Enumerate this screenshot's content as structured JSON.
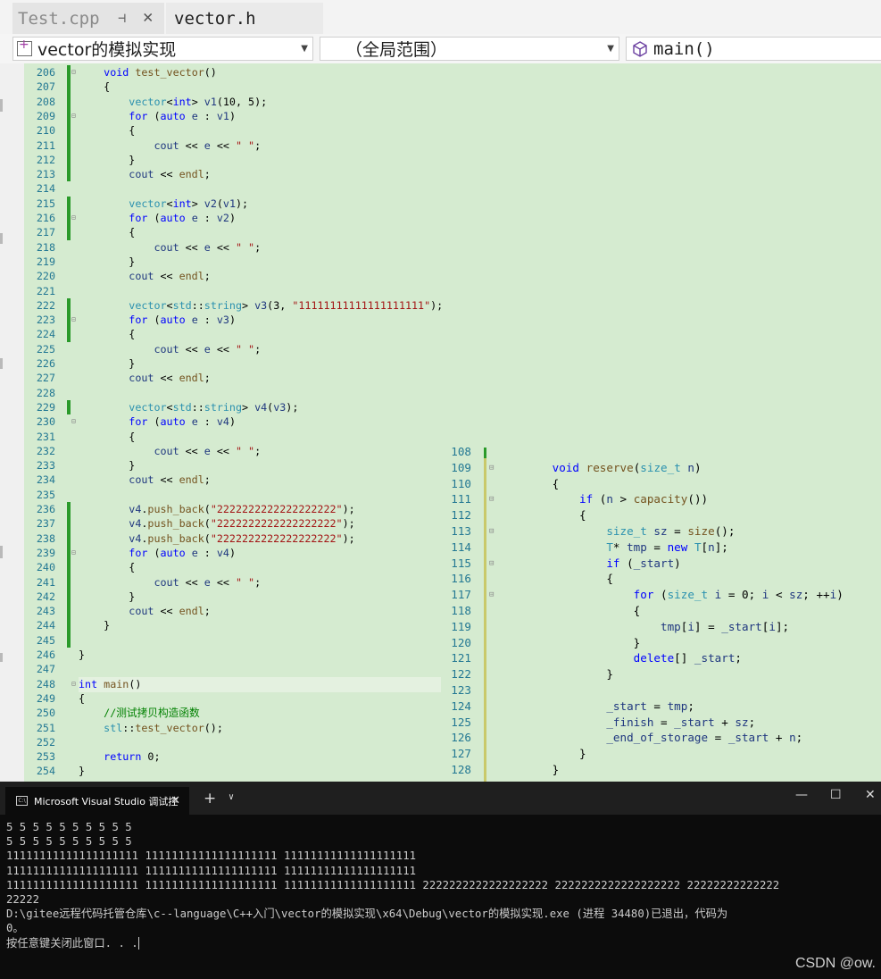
{
  "tabs": [
    {
      "label": "Test.cpp",
      "active": false,
      "pin": "⊣",
      "close": "✕"
    },
    {
      "label": "vector.h",
      "active": true
    }
  ],
  "navbar": {
    "project": "vector的模拟实现",
    "scope": "（全局范围）",
    "member": "main()"
  },
  "editor": {
    "lines": [
      {
        "n": "206",
        "html": "    <span class='kw'>void</span> <span class='fn'>test_vector</span>()"
      },
      {
        "n": "207",
        "html": "    {"
      },
      {
        "n": "208",
        "html": "        <span class='ty'>vector</span>&lt;<span class='kw'>int</span>&gt; <span class='var'>v1</span>(10, 5);"
      },
      {
        "n": "209",
        "html": "        <span class='kw'>for</span> (<span class='kw'>auto</span> <span class='var'>e</span> : <span class='var'>v1</span>)"
      },
      {
        "n": "210",
        "html": "        {"
      },
      {
        "n": "211",
        "html": "            <span class='var'>cout</span> &lt;&lt; <span class='var'>e</span> &lt;&lt; <span class='str'>\" \"</span>;"
      },
      {
        "n": "212",
        "html": "        }"
      },
      {
        "n": "213",
        "html": "        <span class='var'>cout</span> &lt;&lt; <span class='fn'>endl</span>;"
      },
      {
        "n": "214",
        "html": ""
      },
      {
        "n": "215",
        "html": "        <span class='ty'>vector</span>&lt;<span class='kw'>int</span>&gt; <span class='var'>v2</span>(<span class='var'>v1</span>);"
      },
      {
        "n": "216",
        "html": "        <span class='kw'>for</span> (<span class='kw'>auto</span> <span class='var'>e</span> : <span class='var'>v2</span>)"
      },
      {
        "n": "217",
        "html": "        {"
      },
      {
        "n": "218",
        "html": "            <span class='var'>cout</span> &lt;&lt; <span class='var'>e</span> &lt;&lt; <span class='str'>\" \"</span>;"
      },
      {
        "n": "219",
        "html": "        }"
      },
      {
        "n": "220",
        "html": "        <span class='var'>cout</span> &lt;&lt; <span class='fn'>endl</span>;"
      },
      {
        "n": "221",
        "html": ""
      },
      {
        "n": "222",
        "html": "        <span class='ty'>vector</span>&lt;<span class='ns'>std</span>::<span class='ty'>string</span>&gt; <span class='var'>v3</span>(3, <span class='str'>\"11111111111111111111\"</span>);"
      },
      {
        "n": "223",
        "html": "        <span class='kw'>for</span> (<span class='kw'>auto</span> <span class='var'>e</span> : <span class='var'>v3</span>)"
      },
      {
        "n": "224",
        "html": "        {"
      },
      {
        "n": "225",
        "html": "            <span class='var'>cout</span> &lt;&lt; <span class='var'>e</span> &lt;&lt; <span class='str'>\" \"</span>;"
      },
      {
        "n": "226",
        "html": "        }"
      },
      {
        "n": "227",
        "html": "        <span class='var'>cout</span> &lt;&lt; <span class='fn'>endl</span>;"
      },
      {
        "n": "228",
        "html": ""
      },
      {
        "n": "229",
        "html": "        <span class='ty'>vector</span>&lt;<span class='ns'>std</span>::<span class='ty'>string</span>&gt; <span class='var'>v4</span>(<span class='var'>v3</span>);"
      },
      {
        "n": "230",
        "html": "        <span class='kw'>for</span> (<span class='kw'>auto</span> <span class='var'>e</span> : <span class='var'>v4</span>)"
      },
      {
        "n": "231",
        "html": "        {"
      },
      {
        "n": "232",
        "html": "            <span class='var'>cout</span> &lt;&lt; <span class='var'>e</span> &lt;&lt; <span class='str'>\" \"</span>;"
      },
      {
        "n": "233",
        "html": "        }"
      },
      {
        "n": "234",
        "html": "        <span class='var'>cout</span> &lt;&lt; <span class='fn'>endl</span>;"
      },
      {
        "n": "235",
        "html": ""
      },
      {
        "n": "236",
        "html": "        <span class='var'>v4</span>.<span class='fn'>push_back</span>(<span class='str'>\"2222222222222222222\"</span>);"
      },
      {
        "n": "237",
        "html": "        <span class='var'>v4</span>.<span class='fn'>push_back</span>(<span class='str'>\"2222222222222222222\"</span>);"
      },
      {
        "n": "238",
        "html": "        <span class='var'>v4</span>.<span class='fn'>push_back</span>(<span class='str'>\"2222222222222222222\"</span>);"
      },
      {
        "n": "239",
        "html": "        <span class='kw'>for</span> (<span class='kw'>auto</span> <span class='var'>e</span> : <span class='var'>v4</span>)"
      },
      {
        "n": "240",
        "html": "        {"
      },
      {
        "n": "241",
        "html": "            <span class='var'>cout</span> &lt;&lt; <span class='var'>e</span> &lt;&lt; <span class='str'>\" \"</span>;"
      },
      {
        "n": "242",
        "html": "        }"
      },
      {
        "n": "243",
        "html": "        <span class='var'>cout</span> &lt;&lt; <span class='fn'>endl</span>;"
      },
      {
        "n": "244",
        "html": "    }"
      },
      {
        "n": "245",
        "html": ""
      },
      {
        "n": "246",
        "html": "}"
      },
      {
        "n": "247",
        "html": ""
      },
      {
        "n": "248",
        "html": "<span class='kw'>int</span> <span class='fn'>main</span>()"
      },
      {
        "n": "249",
        "html": "{"
      },
      {
        "n": "250",
        "html": "    <span class='cm'>//测试拷贝构造函数</span>"
      },
      {
        "n": "251",
        "html": "    <span class='ns'>stl</span>::<span class='fn'>test_vector</span>();"
      },
      {
        "n": "252",
        "html": ""
      },
      {
        "n": "253",
        "html": "    <span class='kw'>return</span> 0;"
      },
      {
        "n": "254",
        "html": "}"
      }
    ],
    "peek": [
      {
        "n": "108",
        "html": ""
      },
      {
        "n": "109",
        "html": "        <span class='kw'>void</span> <span class='fn'>reserve</span>(<span class='ty'>size_t</span> <span class='var'>n</span>)"
      },
      {
        "n": "110",
        "html": "        {"
      },
      {
        "n": "111",
        "html": "            <span class='kw'>if</span> (<span class='var'>n</span> &gt; <span class='fn'>capacity</span>())"
      },
      {
        "n": "112",
        "html": "            {"
      },
      {
        "n": "113",
        "html": "                <span class='ty'>size_t</span> <span class='var'>sz</span> = <span class='fn'>size</span>();"
      },
      {
        "n": "114",
        "html": "                <span class='ty'>T</span>* <span class='var'>tmp</span> = <span class='kw'>new</span> <span class='ty'>T</span>[<span class='var'>n</span>];"
      },
      {
        "n": "115",
        "html": "                <span class='kw'>if</span> (<span class='var'>_start</span>)"
      },
      {
        "n": "116",
        "html": "                {"
      },
      {
        "n": "117",
        "html": "                    <span class='kw'>for</span> (<span class='ty'>size_t</span> <span class='var'>i</span> = 0; <span class='var'>i</span> &lt; <span class='var'>sz</span>; ++<span class='var'>i</span>)"
      },
      {
        "n": "118",
        "html": "                    {"
      },
      {
        "n": "119",
        "html": "                        <span class='var'>tmp</span>[<span class='var'>i</span>] = <span class='var'>_start</span>[<span class='var'>i</span>];"
      },
      {
        "n": "120",
        "html": "                    }"
      },
      {
        "n": "121",
        "html": "                    <span class='kw'>delete</span>[] <span class='var'>_start</span>;"
      },
      {
        "n": "122",
        "html": "                }"
      },
      {
        "n": "123",
        "html": ""
      },
      {
        "n": "124",
        "html": "                <span class='var'>_start</span> = <span class='var'>tmp</span>;"
      },
      {
        "n": "125",
        "html": "                <span class='var'>_finish</span> = <span class='var'>_start</span> + <span class='var'>sz</span>;"
      },
      {
        "n": "126",
        "html": "                <span class='var'>_end_of_storage</span> = <span class='var'>_start</span> + <span class='var'>n</span>;"
      },
      {
        "n": "127",
        "html": "            }"
      },
      {
        "n": "128",
        "html": "        }"
      }
    ]
  },
  "console": {
    "tab_title": "Microsoft Visual Studio 调试控",
    "tab_close": "✕",
    "plus": "+",
    "dropdown": "∨",
    "minimize": "—",
    "maximize": "☐",
    "close": "✕",
    "output": [
      "5 5 5 5 5 5 5 5 5 5",
      "5 5 5 5 5 5 5 5 5 5",
      "11111111111111111111 11111111111111111111 11111111111111111111",
      "11111111111111111111 11111111111111111111 11111111111111111111",
      "11111111111111111111 11111111111111111111 11111111111111111111 2222222222222222222 2222222222222222222 22222222222222",
      "22222",
      "",
      "D:\\gitee远程代码托管仓库\\c--language\\C++入门\\vector的模拟实现\\x64\\Debug\\vector的模拟实现.exe (进程 34480)已退出，代码为",
      "0。",
      "按任意键关闭此窗口. . ."
    ],
    "watermark": "CSDN @ow."
  }
}
